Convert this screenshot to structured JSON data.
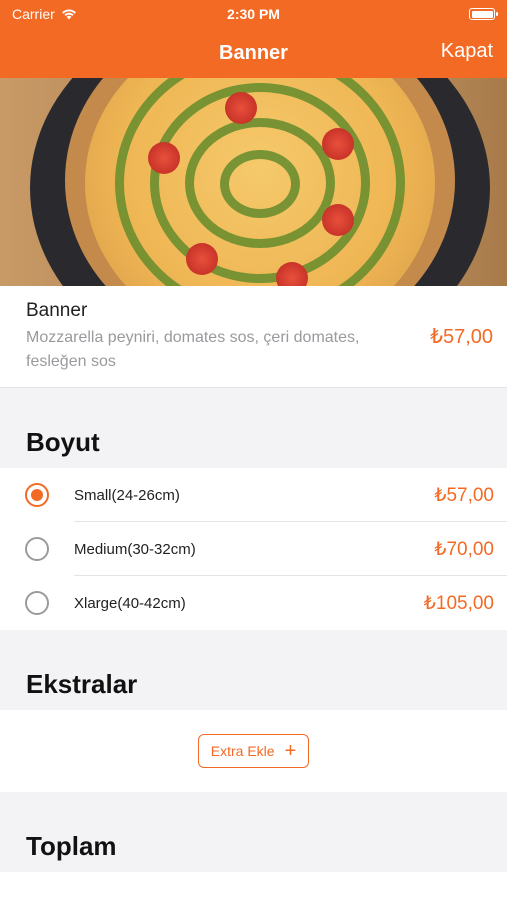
{
  "status_bar": {
    "carrier": "Carrier",
    "time": "2:30 PM"
  },
  "nav": {
    "title": "Banner",
    "close_label": "Kapat"
  },
  "product": {
    "name": "Banner",
    "description": "Mozzarella peyniri, domates sos, çeri domates, fesleğen sos",
    "price": "₺57,00"
  },
  "size_section": {
    "title": "Boyut",
    "options": [
      {
        "label": "Small(24-26cm)",
        "price": "₺57,00",
        "selected": true
      },
      {
        "label": "Medium(30-32cm)",
        "price": "₺70,00",
        "selected": false
      },
      {
        "label": "Xlarge(40-42cm)",
        "price": "₺105,00",
        "selected": false
      }
    ]
  },
  "extras_section": {
    "title": "Ekstralar",
    "button_label": "Extra Ekle",
    "button_icon": "plus-icon"
  },
  "total_section": {
    "title": "Toplam"
  },
  "colors": {
    "accent": "#f26a24"
  }
}
